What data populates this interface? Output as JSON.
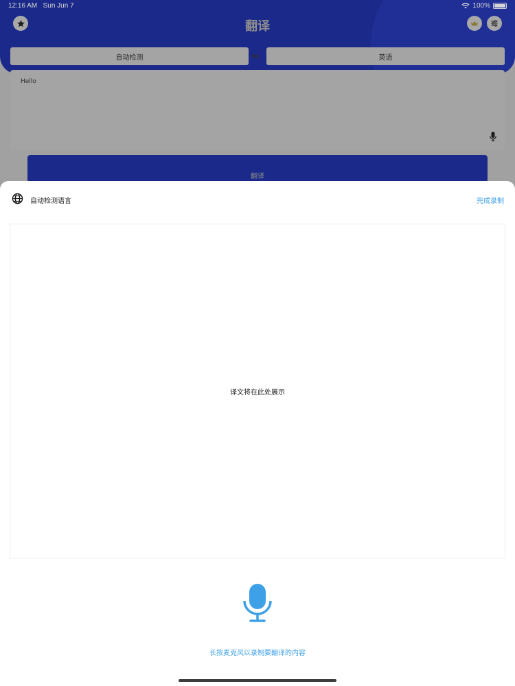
{
  "status_bar": {
    "time": "12:16 AM",
    "date": "Sun Jun 7",
    "battery": "100%"
  },
  "header": {
    "title": "翻译"
  },
  "languages": {
    "source": "自动检测",
    "target": "英语",
    "swap_icon": "⇋"
  },
  "input": {
    "value": "Hello"
  },
  "translate_button": {
    "label": "翻译"
  },
  "sheet": {
    "language_label": "自动检测语言",
    "done_label": "完成录制",
    "result_placeholder": "译文将在此处展示",
    "hint": "长按麦克风以录制要翻译的内容"
  },
  "colors": {
    "accent": "#3ea0e6",
    "header": "#1b2a8a"
  }
}
